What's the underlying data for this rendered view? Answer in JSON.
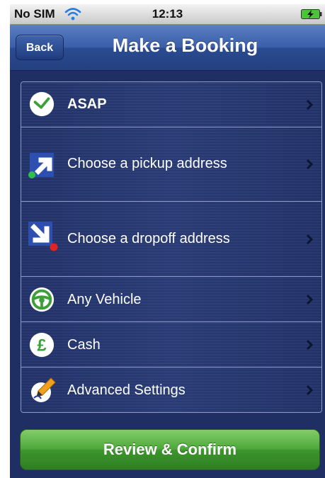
{
  "status_bar": {
    "carrier": "No SIM",
    "time": "12:13",
    "wifi_icon": "wifi-icon",
    "battery_icon": "battery-charging-icon"
  },
  "nav": {
    "back_label": "Back",
    "title": "Make a Booking"
  },
  "booking_options": [
    {
      "label": "ASAP",
      "icon": "clock-icon"
    },
    {
      "label": "Choose a pickup address",
      "icon": "pickup-arrow-icon"
    },
    {
      "label": "Choose a dropoff address",
      "icon": "dropoff-arrow-icon"
    },
    {
      "label": "Any Vehicle",
      "icon": "steering-wheel-icon"
    },
    {
      "label": "Cash",
      "icon": "pound-icon"
    },
    {
      "label": "Advanced Settings",
      "icon": "pen-icon"
    }
  ],
  "review_button_label": "Review & Confirm",
  "colors": {
    "background": "#1f2f63",
    "accent_green": "#4da83b",
    "nav_blue": "#3a5fa8"
  }
}
